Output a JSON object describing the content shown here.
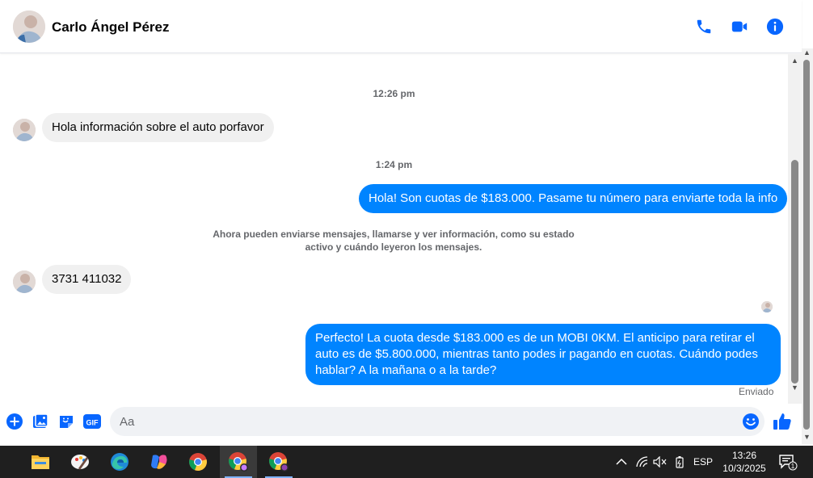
{
  "header": {
    "contact_name": "Carlo Ángel Pérez",
    "icons": [
      "phone-icon",
      "video-camera-icon",
      "info-icon"
    ]
  },
  "messages": {
    "timestamp_1": "12:26 pm",
    "msg_1": "Hola información sobre el auto porfavor",
    "timestamp_2": "1:24 pm",
    "msg_2": "Hola! Son cuotas de $183.000. Pasame tu número para enviarte toda la info",
    "system_note_line1": "Ahora pueden enviarse mensajes, llamarse y ver información, como su estado",
    "system_note_line2": "activo y cuándo leyeron los mensajes.",
    "msg_3": "3731 411032",
    "msg_4_line1": "Perfecto! La cuota desde $183.000 es de un MOBI 0KM. El anticipo para retirar el",
    "msg_4_line2": "auto es de $5.800.000, mientras tanto podes ir pagando en cuotas. Cuándo podes",
    "msg_4_line3": "hablar? A la mañana o a la tarde?",
    "status": "Enviado"
  },
  "composer": {
    "placeholder": "Aa",
    "icons": [
      "plus-icon",
      "photo-icon",
      "sticker-icon",
      "gif-icon",
      "emoji-icon",
      "thumbs-up-icon"
    ],
    "gif_label": "GIF"
  },
  "taskbar": {
    "tray_lang": "ESP",
    "time": "13:26",
    "date": "10/3/2025",
    "notification_count": "1"
  },
  "colors": {
    "accent": "#0866ff",
    "outgoing_bubble": "#0084ff",
    "incoming_bubble": "#f0f0f0"
  }
}
